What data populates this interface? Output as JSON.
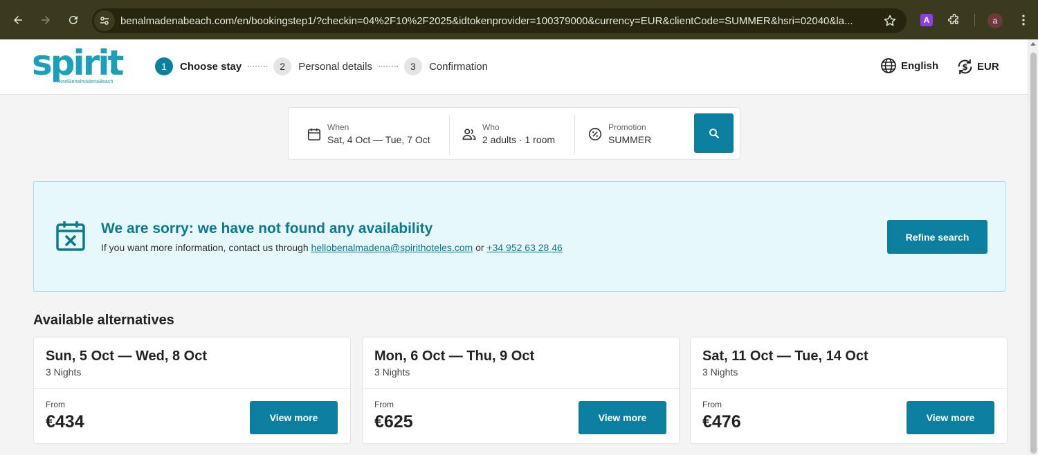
{
  "browser": {
    "url": "benalmadenabeach.com/en/bookingstep1/?checkin=04%2F10%2F2025&idtokenprovider=100379000&currency=EUR&clientCode=SUMMER&hsri=02040&la...",
    "extension_label": "A",
    "profile_initial": "a"
  },
  "header": {
    "logo_word": "spirit",
    "logo_sub": "HotelBenalmádenaBeach",
    "steps": [
      {
        "num": "1",
        "label": "Choose stay"
      },
      {
        "num": "2",
        "label": "Personal details"
      },
      {
        "num": "3",
        "label": "Confirmation"
      }
    ],
    "language": "English",
    "currency": "EUR"
  },
  "search": {
    "when_label": "When",
    "when_value": "Sat, 4 Oct — Tue, 7 Oct",
    "who_label": "Who",
    "who_value": "2 adults · 1 room",
    "promo_label": "Promotion",
    "promo_value": "SUMMER"
  },
  "alert": {
    "title": "We are sorry: we have not found any availability",
    "msg_prefix": "If you want more information, contact us through ",
    "email": "hellobenalmadena@spirithoteles.com",
    "msg_or": " or ",
    "phone": "+34 952 63 28 46",
    "refine_label": "Refine search"
  },
  "alternatives": {
    "heading": "Available alternatives",
    "cards": [
      {
        "dates": "Sun, 5 Oct — Wed, 8 Oct",
        "nights": "3 Nights",
        "from": "From",
        "price": "€434",
        "button": "View more"
      },
      {
        "dates": "Mon, 6 Oct — Thu, 9 Oct",
        "nights": "3 Nights",
        "from": "From",
        "price": "€625",
        "button": "View more"
      },
      {
        "dates": "Sat, 11 Oct — Tue, 14 Oct",
        "nights": "3 Nights",
        "from": "From",
        "price": "€476",
        "button": "View more"
      }
    ]
  },
  "colors": {
    "brand": "#0c7ea0",
    "logo": "#1aa0b8",
    "alert_bg": "#e6f8fb",
    "alert_title": "#0b7a8e"
  }
}
